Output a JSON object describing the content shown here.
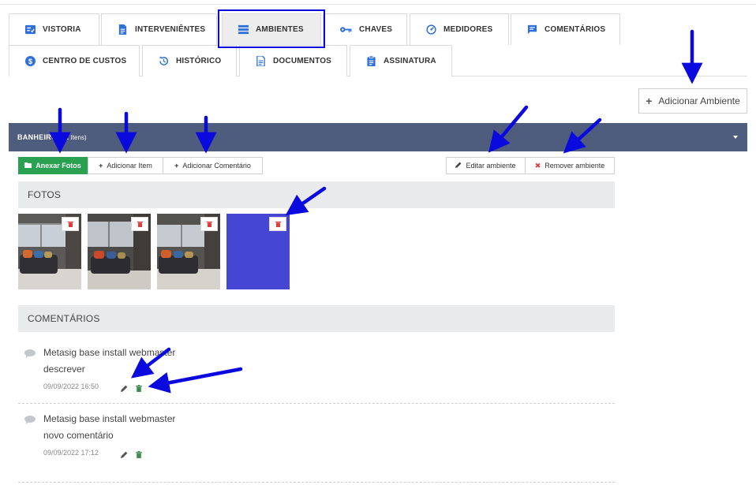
{
  "tabs": {
    "row1": [
      {
        "label": "VISTORIA",
        "icon": "checklist-icon"
      },
      {
        "label": "INTERVENIÊNTES",
        "icon": "document-icon"
      },
      {
        "label": "AMBIENTES",
        "icon": "layers-icon"
      },
      {
        "label": "CHAVES",
        "icon": "key-icon"
      },
      {
        "label": "MEDIDORES",
        "icon": "gauge-icon"
      },
      {
        "label": "COMENTÁRIOS",
        "icon": "comment-icon"
      }
    ],
    "row2": [
      {
        "label": "CENTRO DE CUSTOS",
        "icon": "dollar-icon"
      },
      {
        "label": "HISTÓRICO",
        "icon": "history-icon"
      },
      {
        "label": "DOCUMENTOS",
        "icon": "document-icon"
      },
      {
        "label": "ASSINATURA",
        "icon": "clipboard-icon"
      }
    ],
    "active": "AMBIENTES"
  },
  "add_room_button": "Adicionar Ambiente",
  "room": {
    "name": "BANHEIRO",
    "count": "(11 Itens)"
  },
  "actions": {
    "attach_photos": "Anexar Fotos",
    "add_item": "Adicionar Item",
    "add_comment": "Adicionar Comentário",
    "edit_room": "Editar ambiente",
    "remove_room": "Remover ambiente"
  },
  "photos_section": {
    "title": "FOTOS"
  },
  "photos": [
    {
      "kind": "room-photo"
    },
    {
      "kind": "room-photo"
    },
    {
      "kind": "room-photo"
    },
    {
      "kind": "placeholder",
      "color": "#4646d4"
    }
  ],
  "comments_section": {
    "title": "COMENTÁRIOS"
  },
  "comments": [
    {
      "author": "Metasig base install webmaster",
      "text": "descrever",
      "date": "09/09/2022 16:50"
    },
    {
      "author": "Metasig base install webmaster",
      "text": "novo comentário",
      "date": "09/09/2022 17:12"
    }
  ],
  "colors": {
    "accent_blue": "#2f6fd9",
    "header_bg": "#4e5d7e",
    "green": "#2aa150",
    "danger": "#e03b3b",
    "annotation": "#0a0adf"
  }
}
